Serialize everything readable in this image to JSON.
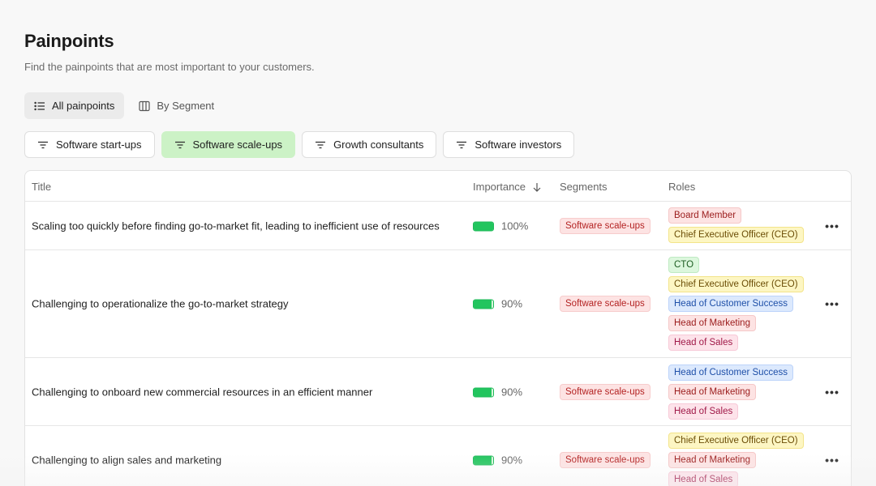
{
  "header": {
    "title": "Painpoints",
    "subtitle": "Find the painpoints that are most important to your customers."
  },
  "view_tabs": [
    {
      "label": "All painpoints",
      "icon": "list-icon",
      "active": true
    },
    {
      "label": "By Segment",
      "icon": "columns-icon",
      "active": false
    }
  ],
  "segment_filters": [
    {
      "label": "Software start-ups",
      "icon": "filter-icon",
      "active": false
    },
    {
      "label": "Software scale-ups",
      "icon": "filter-icon",
      "active": true
    },
    {
      "label": "Growth consultants",
      "icon": "filter-icon",
      "active": false
    },
    {
      "label": "Software investors",
      "icon": "filter-icon",
      "active": false
    }
  ],
  "table": {
    "columns": {
      "title": "Title",
      "importance": "Importance",
      "segments": "Segments",
      "roles": "Roles"
    },
    "sort_icon": "arrow-down-icon",
    "rows": [
      {
        "title": "Scaling too quickly before finding go-to-market fit, leading to inefficient use of resources",
        "importance": "100%",
        "importance_fraction": 1.0,
        "segment": "Software scale-ups",
        "roles": [
          {
            "label": "Board Member",
            "color": "red"
          },
          {
            "label": "Chief Executive Officer (CEO)",
            "color": "yellow"
          }
        ],
        "more": "•••"
      },
      {
        "title": "Challenging to operationalize the go-to-market strategy",
        "importance": "90%",
        "importance_fraction": 0.9,
        "segment": "Software scale-ups",
        "roles": [
          {
            "label": "CTO",
            "color": "green"
          },
          {
            "label": "Chief Executive Officer (CEO)",
            "color": "yellow"
          },
          {
            "label": "Head of Customer Success",
            "color": "blue"
          },
          {
            "label": "Head of Marketing",
            "color": "red"
          },
          {
            "label": "Head of Sales",
            "color": "pink"
          }
        ],
        "more": "•••"
      },
      {
        "title": "Challenging to onboard new commercial resources in an efficient manner",
        "importance": "90%",
        "importance_fraction": 0.9,
        "segment": "Software scale-ups",
        "roles": [
          {
            "label": "Head of Customer Success",
            "color": "blue"
          },
          {
            "label": "Head of Marketing",
            "color": "red"
          },
          {
            "label": "Head of Sales",
            "color": "pink"
          }
        ],
        "more": "•••"
      },
      {
        "title": "Challenging to align sales and marketing",
        "importance": "90%",
        "importance_fraction": 0.9,
        "segment": "Software scale-ups",
        "roles": [
          {
            "label": "Chief Executive Officer (CEO)",
            "color": "yellow"
          },
          {
            "label": "Head of Marketing",
            "color": "red"
          },
          {
            "label": "Head of Sales",
            "color": "pink"
          }
        ],
        "more": "•••"
      }
    ]
  },
  "colors": {
    "active_segment_bg": "#ccf2c6",
    "importance_green": "#22c55e"
  }
}
